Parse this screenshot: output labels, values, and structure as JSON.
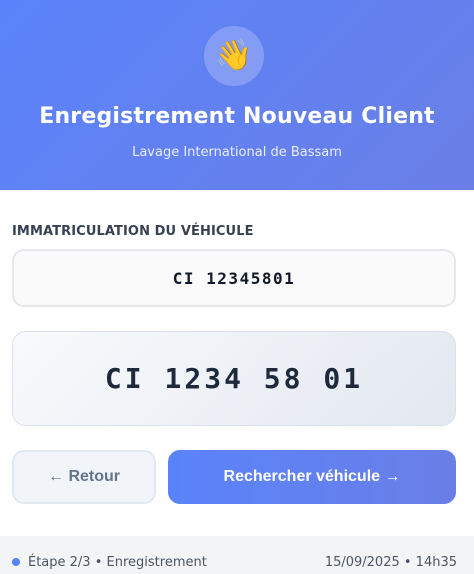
{
  "header": {
    "icon": "waving-hand-icon",
    "icon_glyph": "👋",
    "title": "Enregistrement Nouveau Client",
    "subtitle": "Lavage International de Bassam"
  },
  "form": {
    "plate_label": "IMMATRICULATION DU VÉHICULE",
    "plate_value": "CI 12345801",
    "plate_preview": "CI 1234 58 01"
  },
  "actions": {
    "back_label": "← Retour",
    "search_label": "Rechercher véhicule →"
  },
  "footer": {
    "step": "Étape 2/3 • Enregistrement",
    "datetime": "15/09/2025 • 14h35"
  },
  "colors": {
    "accent": "#5a83fb",
    "accent_end": "#6a7fe6"
  }
}
